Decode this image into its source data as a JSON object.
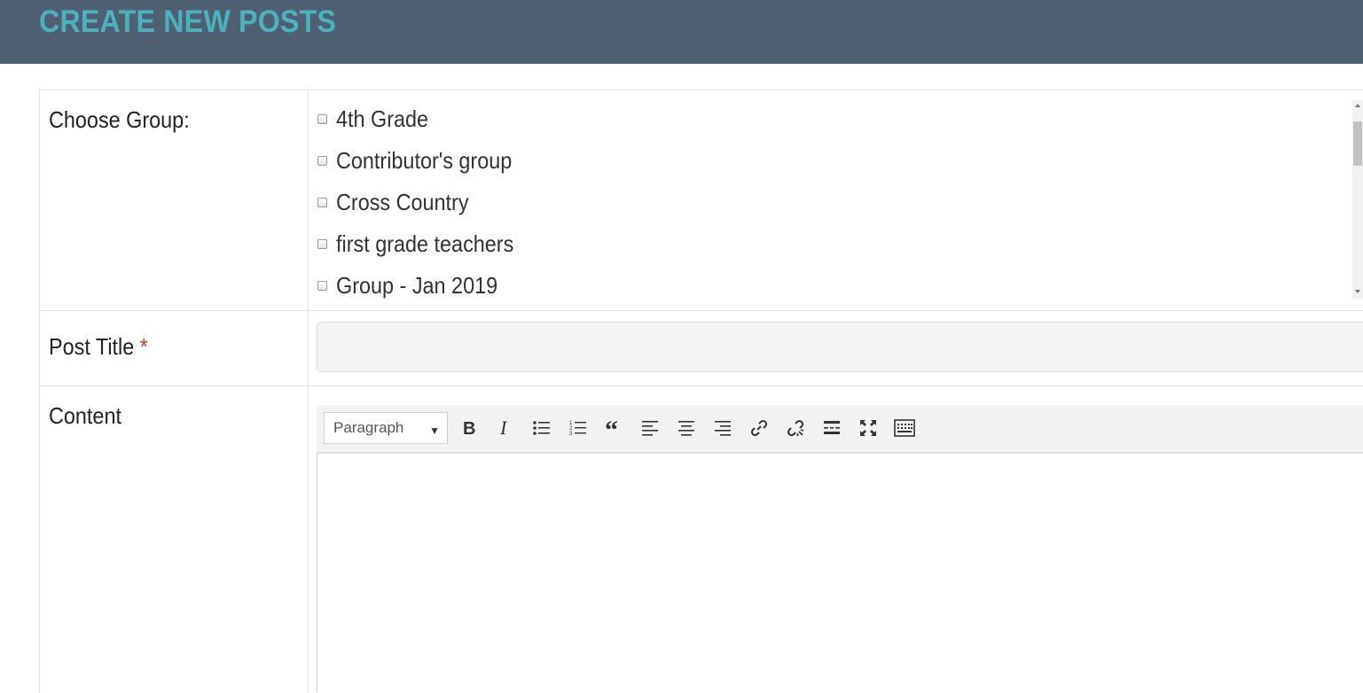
{
  "header": {
    "title": "CREATE NEW POSTS"
  },
  "form": {
    "group_label": "Choose Group:",
    "groups": [
      "4th Grade",
      "Contributor's group",
      "Cross Country",
      "first grade teachers",
      "Group - Jan 2019"
    ],
    "title_label": "Post Title",
    "required_mark": "*",
    "title_value": "",
    "content_label": "Content"
  },
  "editor": {
    "format_value": "Paragraph",
    "tools": [
      "bold-icon",
      "italic-icon",
      "bullet-list-icon",
      "numbered-list-icon",
      "blockquote-icon",
      "align-left-icon",
      "align-center-icon",
      "align-right-icon",
      "link-icon",
      "unlink-icon",
      "read-more-icon",
      "fullscreen-icon",
      "toolbar-toggle-icon"
    ]
  },
  "colors": {
    "header_bg": "#4f6072",
    "header_text": "#4bb1bd",
    "required": "#c0392b"
  }
}
